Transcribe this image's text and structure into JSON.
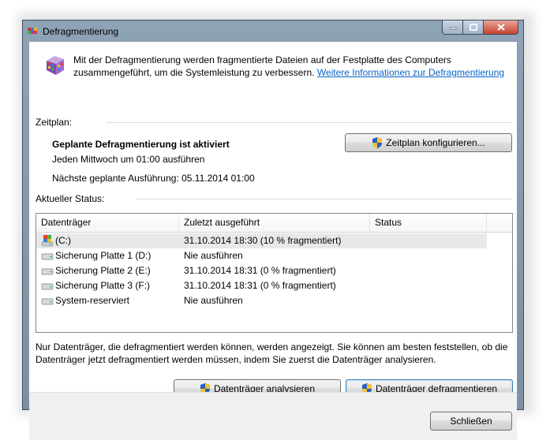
{
  "window": {
    "title": "Defragmentierung"
  },
  "intro": {
    "text": "Mit der Defragmentierung werden fragmentierte Dateien auf der Festplatte des Computers zusammengeführt, um die Systemleistung zu verbessern.",
    "link": "Weitere Informationen zur Defragmentierung"
  },
  "schedule": {
    "section_label": "Zeitplan:",
    "status_title": "Geplante Defragmentierung ist aktiviert",
    "frequency": "Jeden Mittwoch um 01:00 ausführen",
    "next_run": "Nächste geplante Ausführung: 05.11.2014 01:00",
    "configure_button": "Zeitplan konfigurieren..."
  },
  "status": {
    "section_label": "Aktueller Status:",
    "columns": [
      "Datenträger",
      "Zuletzt ausgeführt",
      "Status"
    ],
    "rows": [
      {
        "drive": "(C:)",
        "last_run": "31.10.2014 18:30 (10 % fragmentiert)",
        "status": "",
        "icon": "windows-drive-icon",
        "selected": true
      },
      {
        "drive": "Sicherung Platte 1 (D:)",
        "last_run": "Nie ausführen",
        "status": "",
        "icon": "drive-icon"
      },
      {
        "drive": "Sicherung Platte 2 (E:)",
        "last_run": "31.10.2014 18:31 (0 % fragmentiert)",
        "status": "",
        "icon": "drive-icon"
      },
      {
        "drive": "Sicherung Platte 3 (F:)",
        "last_run": "31.10.2014 18:31 (0 % fragmentiert)",
        "status": "",
        "icon": "drive-icon"
      },
      {
        "drive": "System-reserviert",
        "last_run": "Nie ausführen",
        "status": "",
        "icon": "drive-icon"
      }
    ]
  },
  "info": {
    "text": "Nur Datenträger, die defragmentiert werden können, werden angezeigt. Sie können am besten feststellen, ob die Datenträger jetzt defragmentiert werden müssen, indem Sie zuerst die Datenträger analysieren."
  },
  "actions": {
    "analyze_button": "Datenträger analysieren",
    "defrag_button": "Datenträger defragmentieren",
    "close_button": "Schließen"
  },
  "colors": {
    "link": "#0a64c6",
    "selected_row": "#e8e8e8",
    "close_caption": "#c8412f"
  }
}
